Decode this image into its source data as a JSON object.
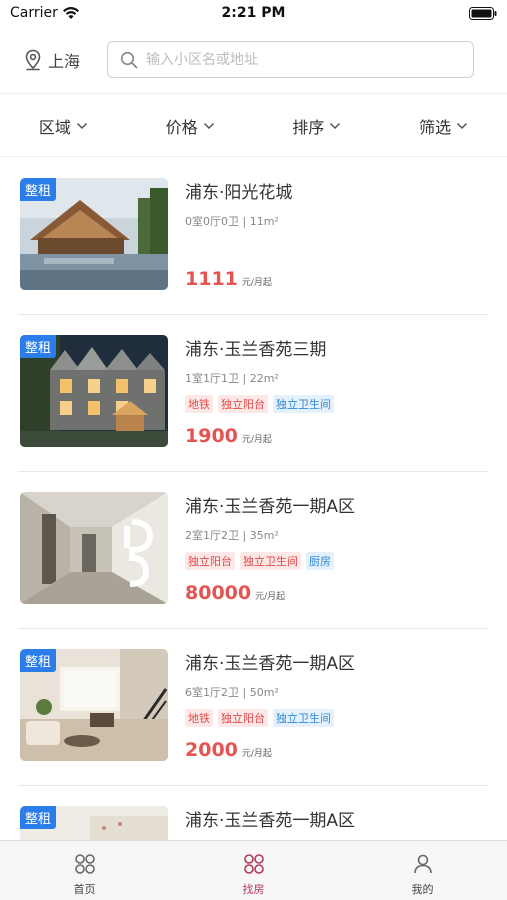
{
  "status_bar": {
    "carrier": "Carrier",
    "time": "2:21 PM"
  },
  "header": {
    "city": "上海",
    "search_placeholder": "输入小区名或地址"
  },
  "filters": [
    {
      "label": "区域"
    },
    {
      "label": "价格"
    },
    {
      "label": "排序"
    },
    {
      "label": "筛选"
    }
  ],
  "listings": [
    {
      "badge": "整租",
      "title": "浦东·阳光花城",
      "spec": "0室0厅0卫 | 11m²",
      "tags": [],
      "price": "1111",
      "price_unit": "元/月起"
    },
    {
      "badge": "整租",
      "title": "浦东·玉兰香苑三期",
      "spec": "1室1厅1卫 | 22m²",
      "tags": [
        "地铁",
        "独立阳台",
        "独立卫生间"
      ],
      "price": "1900",
      "price_unit": "元/月起"
    },
    {
      "badge": "",
      "title": "浦东·玉兰香苑一期A区",
      "spec": "2室1厅2卫 | 35m²",
      "tags": [
        "独立阳台",
        "独立卫生间",
        "厨房"
      ],
      "price": "80000",
      "price_unit": "元/月起"
    },
    {
      "badge": "整租",
      "title": "浦东·玉兰香苑一期A区",
      "spec": "6室1厅2卫 | 50m²",
      "tags": [
        "地铁",
        "独立阳台",
        "独立卫生间"
      ],
      "price": "2000",
      "price_unit": "元/月起"
    },
    {
      "badge": "整租",
      "title": "浦东·玉兰香苑一期A区",
      "spec": "",
      "tags": [],
      "price": "",
      "price_unit": ""
    }
  ],
  "tabbar": {
    "items": [
      {
        "label": "首页",
        "icon": "home-grid-icon"
      },
      {
        "label": "找房",
        "icon": "find-house-grid-icon"
      },
      {
        "label": "我的",
        "icon": "user-icon"
      }
    ],
    "active_color": "#b13a5a"
  },
  "colors": {
    "price": "#e55451",
    "badge": "#2b7de9",
    "tag_red": "#e04a4a",
    "tag_blue": "#3189d6"
  }
}
